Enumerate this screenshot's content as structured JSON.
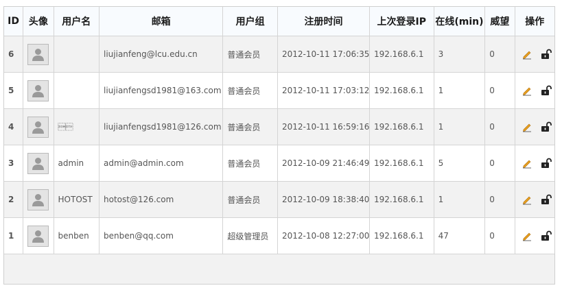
{
  "table": {
    "headers": {
      "id": "ID",
      "avatar": "头像",
      "username": "用户名",
      "email": "邮箱",
      "group": "用户组",
      "regtime": "注册时间",
      "lastip": "上次登录IP",
      "online": "在线(min)",
      "prestige": "威望",
      "actions": "操作"
    },
    "rows": [
      {
        "id": "6",
        "username": "",
        "email": "liujianfeng@lcu.edu.cn",
        "group": "普通会员",
        "regtime": "2012-10-11 17:06:35",
        "lastip": "192.168.6.1",
        "online": "3",
        "prestige": "0"
      },
      {
        "id": "5",
        "username": "",
        "email": "liujianfengsd1981@163.com",
        "group": "普通会员",
        "regtime": "2012-10-11 17:03:12",
        "lastip": "192.168.6.1",
        "online": "1",
        "prestige": "0"
      },
      {
        "id": "4",
        "username": "\u0001\u0002",
        "email": "liujianfengsd1981@126.com",
        "group": "普通会员",
        "regtime": "2012-10-11 16:59:16",
        "lastip": "192.168.6.1",
        "online": "1",
        "prestige": "0"
      },
      {
        "id": "3",
        "username": "admin",
        "email": "admin@admin.com",
        "group": "普通会员",
        "regtime": "2012-10-09 21:46:49",
        "lastip": "192.168.6.1",
        "online": "5",
        "prestige": "0"
      },
      {
        "id": "2",
        "username": "HOTOST",
        "email": "hotost@126.com",
        "group": "普通会员",
        "regtime": "2012-10-09 18:38:40",
        "lastip": "192.168.6.1",
        "online": "1",
        "prestige": "0"
      },
      {
        "id": "1",
        "username": "benben",
        "email": "benben@qq.com",
        "group": "超级管理员",
        "regtime": "2012-10-08 12:27:00",
        "lastip": "192.168.6.1",
        "online": "47",
        "prestige": "0"
      }
    ]
  },
  "icons": {
    "avatar": "default-avatar-icon",
    "edit": "pencil-icon",
    "lock": "unlock-icon"
  },
  "colors": {
    "header_bg": "#f8fbfe",
    "row_odd": "#f2f2f2",
    "row_even": "#ffffff",
    "border": "#d4d4d4",
    "pencil": "#e8a020"
  }
}
